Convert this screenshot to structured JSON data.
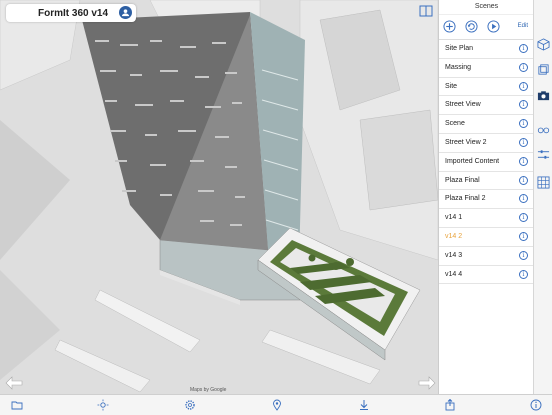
{
  "app": {
    "title": "FormIt 360 v14"
  },
  "viewport": {
    "attribution": "Maps by Google"
  },
  "scenes_panel": {
    "header": "Scenes",
    "edit_label": "Edit",
    "active_index": 10,
    "accent_color": "#e8a33c",
    "items": [
      {
        "label": "Site Plan"
      },
      {
        "label": "Massing"
      },
      {
        "label": "Site"
      },
      {
        "label": "Street View"
      },
      {
        "label": "Scene"
      },
      {
        "label": "Street View 2"
      },
      {
        "label": "Imported Content"
      },
      {
        "label": "Plaza Final"
      },
      {
        "label": "Plaza Final 2"
      },
      {
        "label": "v14 1"
      },
      {
        "label": "v14 2"
      },
      {
        "label": "v14 3"
      },
      {
        "label": "v14 4"
      }
    ]
  },
  "icons": {
    "tools": [
      "add-icon",
      "refresh-icon",
      "play-icon"
    ],
    "rail": [
      "cube-icon",
      "layers-icon",
      "camera-icon",
      "glasses-icon",
      "sliders-icon",
      "grid-icon"
    ],
    "bottom": [
      "folder-icon",
      "sun-icon",
      "gear-icon",
      "location-icon",
      "download-icon",
      "share-icon",
      "info-icon"
    ]
  }
}
